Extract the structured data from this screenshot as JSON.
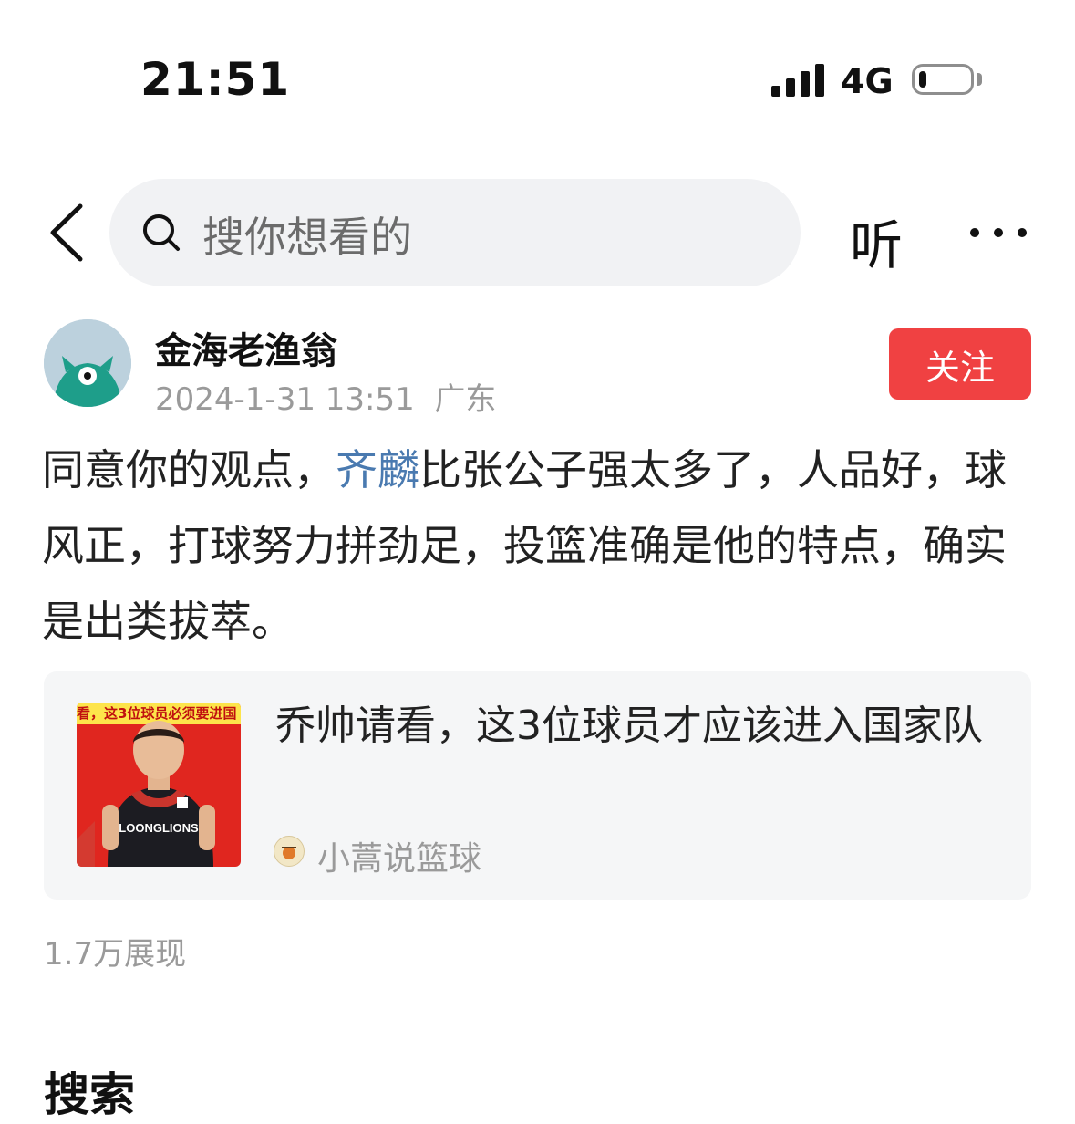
{
  "status_bar": {
    "time": "21:51",
    "network": "4G",
    "battery_level": 0.15
  },
  "nav": {
    "search_placeholder": "搜你想看的",
    "listen_label": "听"
  },
  "author": {
    "name": "金海老渔翁",
    "date": "2024-1-31 13:51",
    "location": "广东",
    "follow_label": "关注"
  },
  "post": {
    "text_before": "同意你的观点，",
    "link_text": "齐麟",
    "text_after": "比张公子强太多了，人品好，球风正，打球努力拼劲足，投篮准确是他的特点，确实是出类拔萃。"
  },
  "linked_card": {
    "title": "乔帅请看，这3位球员才应该进入国家队",
    "thumb_banner": "看，这3位球员必须要进国",
    "thumb_jersey": "LOONGLIONS",
    "source_name": "小蒿说篮球"
  },
  "stats": {
    "views": "1.7万展现"
  },
  "section": {
    "title": "搜索"
  },
  "colors": {
    "follow": "#f04142",
    "link": "#4a7ab0",
    "muted": "#9a9a9a"
  }
}
